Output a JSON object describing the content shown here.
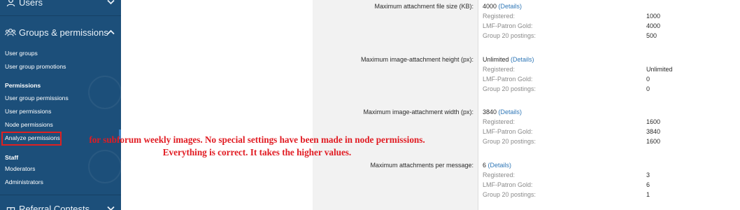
{
  "sidebar": {
    "users_header": "Users",
    "groups_header": "Groups & permissions",
    "referral_header": "Referral Contests",
    "items_top": [
      "User groups",
      "User group promotions"
    ],
    "permissions_title": "Permissions",
    "permissions_items": [
      "User group permissions",
      "User permissions",
      "Node permissions",
      "Analyze permissions"
    ],
    "staff_title": "Staff",
    "staff_items": [
      "Moderators",
      "Administrators"
    ]
  },
  "permissions": [
    {
      "label": "Maximum attachment file size (KB):",
      "value": "4000",
      "details": "(Details)",
      "rows": [
        {
          "group": "Registered:",
          "value": "1000"
        },
        {
          "group": "LMF-Patron Gold:",
          "value": "4000"
        },
        {
          "group": "Group 20 postings:",
          "value": "500"
        }
      ]
    },
    {
      "label": "Maximum image-attachment height (px):",
      "value": "Unlimited",
      "details": "(Details)",
      "rows": [
        {
          "group": "Registered:",
          "value": "Unlimited"
        },
        {
          "group": "LMF-Patron Gold:",
          "value": "0"
        },
        {
          "group": "Group 20 postings:",
          "value": "0"
        }
      ]
    },
    {
      "label": "Maximum image-attachment width (px):",
      "value": "3840",
      "details": "(Details)",
      "rows": [
        {
          "group": "Registered:",
          "value": "1600"
        },
        {
          "group": "LMF-Patron Gold:",
          "value": "3840"
        },
        {
          "group": "Group 20 postings:",
          "value": "1600"
        }
      ]
    },
    {
      "label": "Maximum attachments per message:",
      "value": "6",
      "details": "(Details)",
      "rows": [
        {
          "group": "Registered:",
          "value": "3"
        },
        {
          "group": "LMF-Patron Gold:",
          "value": "6"
        },
        {
          "group": "Group 20 postings:",
          "value": "1"
        }
      ]
    }
  ],
  "annotation": {
    "line1": "for subforum weekly images. No special settings have been made in node permissions.",
    "line2": "Everything is correct. It takes the higher values."
  },
  "colors": {
    "sidebar_bg": "#1c4f7a",
    "link": "#2f77b7",
    "annotation": "#e11b22",
    "highlight_box": "#e02020"
  }
}
